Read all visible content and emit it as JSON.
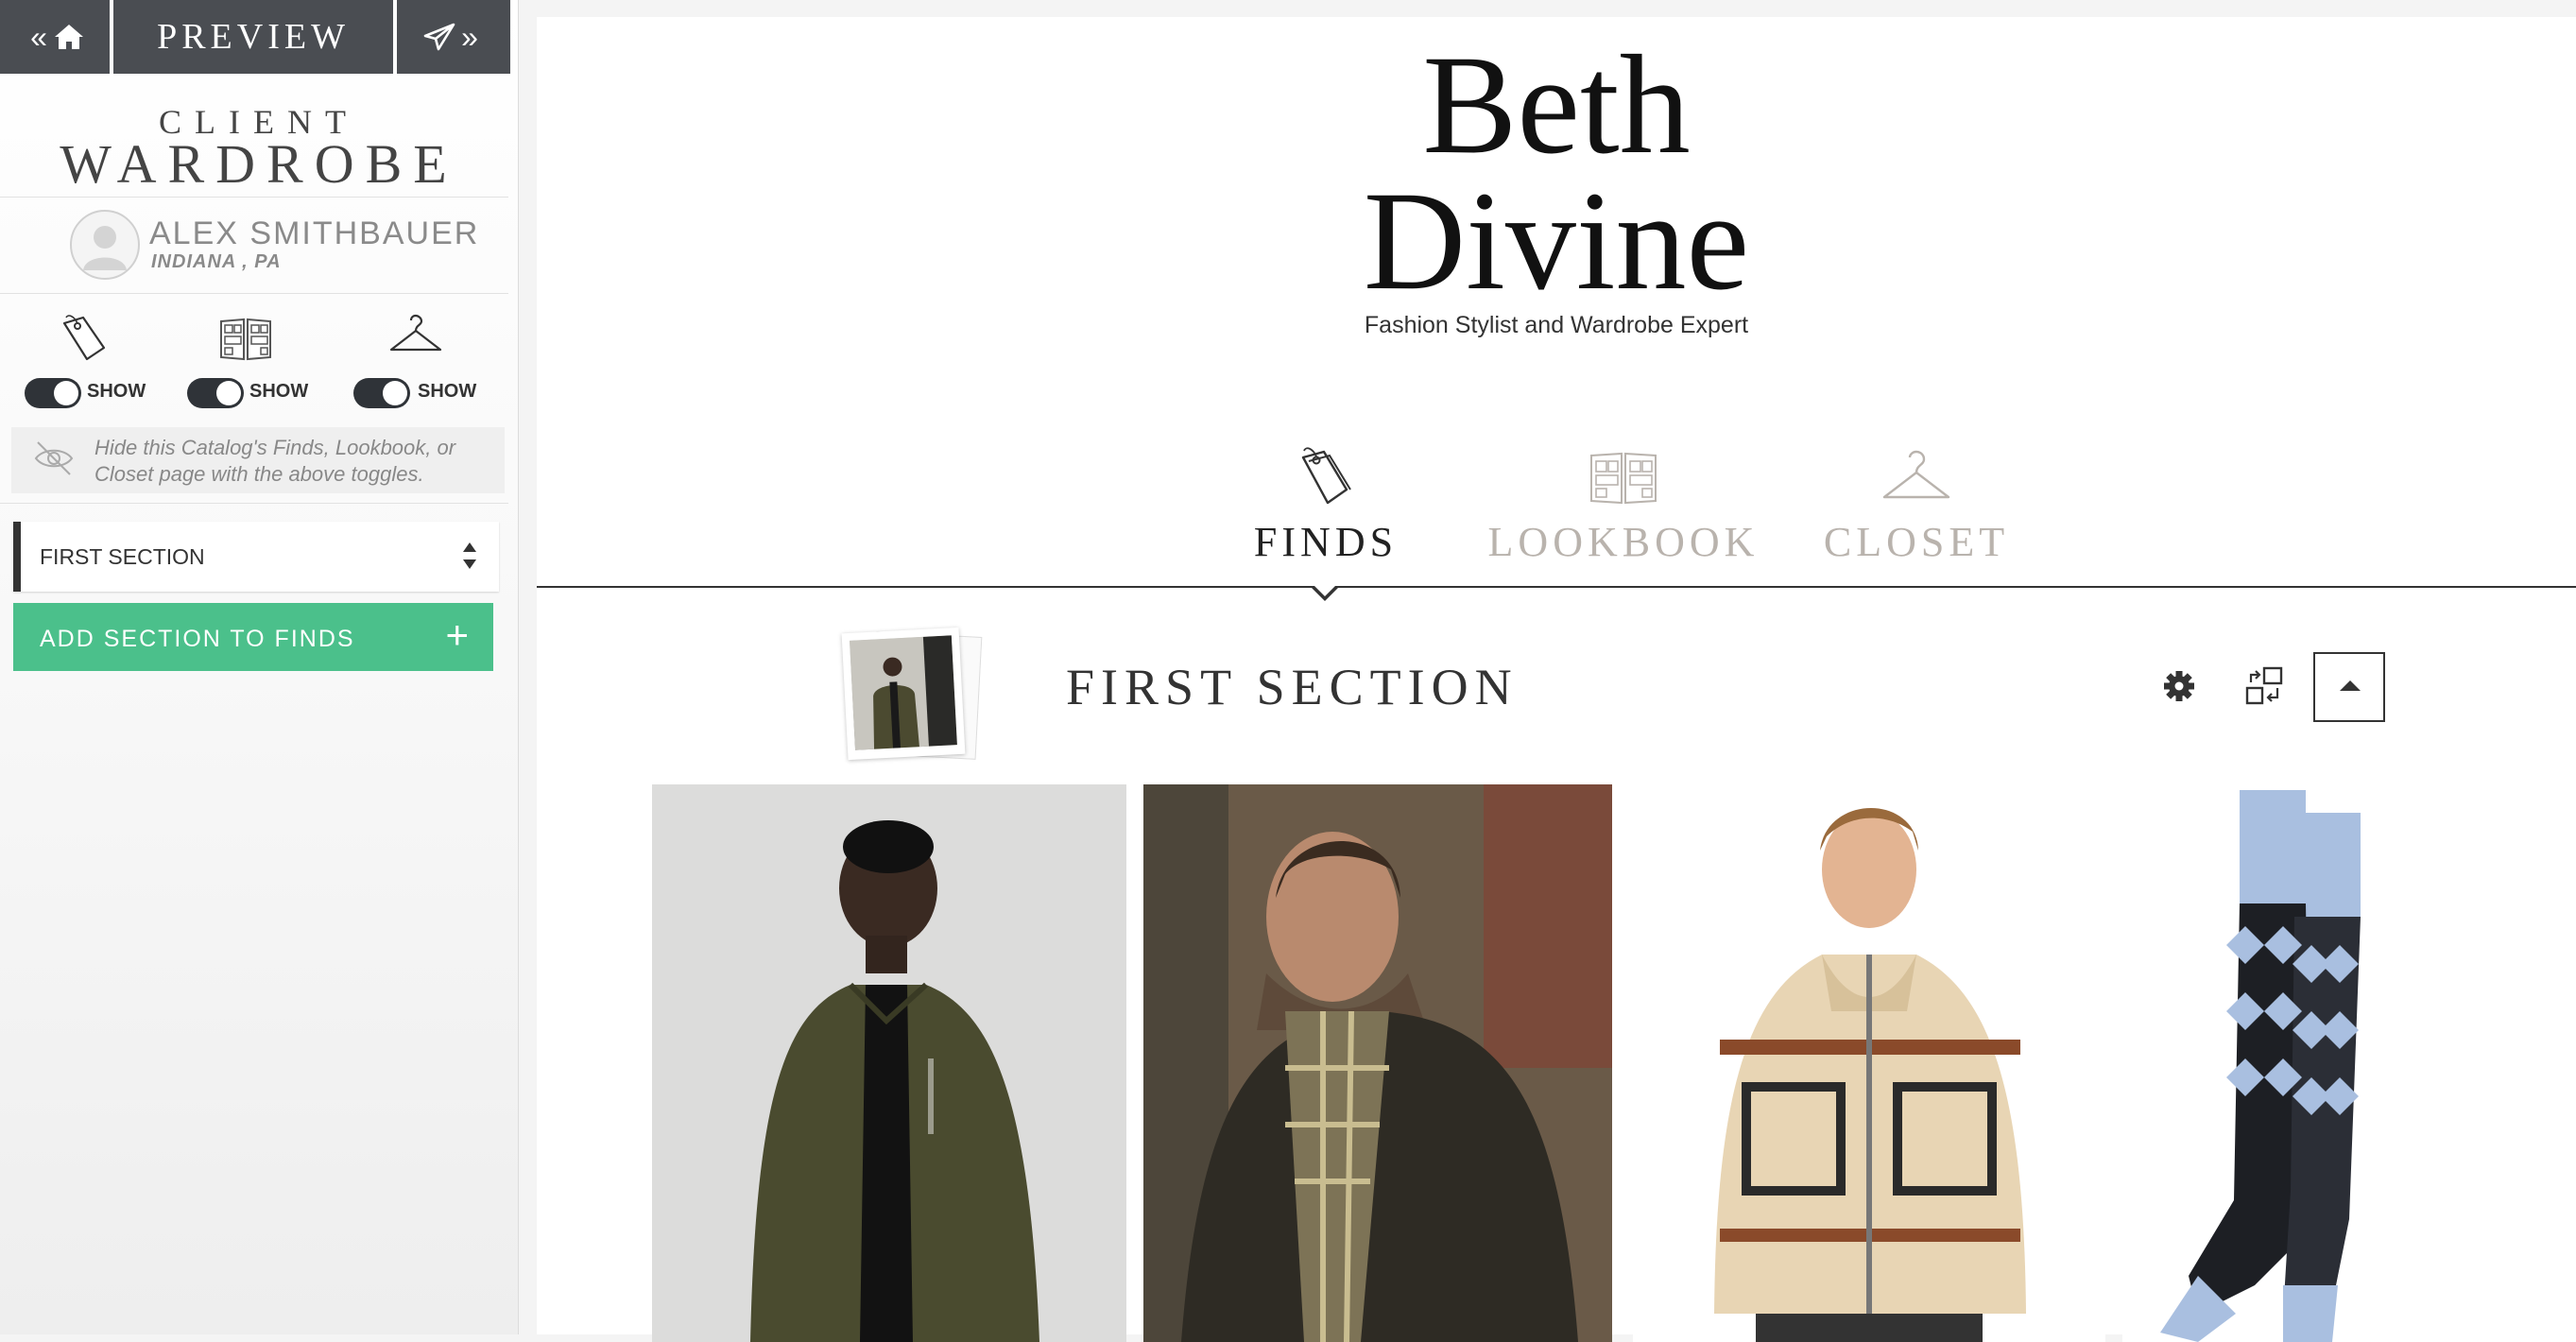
{
  "sidebar": {
    "preview_label": "PREVIEW",
    "title_line1": "CLIENT",
    "title_line2": "WARDROBE",
    "client": {
      "name": "ALEX SMITHBAUER",
      "location": "INDIANA , PA"
    },
    "toggles": [
      {
        "icon": "price-tag-icon",
        "label": "SHOW",
        "on": true
      },
      {
        "icon": "lookbook-icon",
        "label": "SHOW",
        "on": true
      },
      {
        "icon": "hanger-icon",
        "label": "SHOW",
        "on": true
      }
    ],
    "hint": "Hide this Catalog's Finds, Lookbook, or Closet page with the above toggles.",
    "section_select": "FIRST SECTION",
    "add_section_label": "ADD SECTION TO FINDS",
    "add_section_icon": "+"
  },
  "main": {
    "brand_line1": "Beth",
    "brand_line2": "Divine",
    "brand_subtitle": "Fashion Stylist and Wardrobe Expert",
    "tabs": [
      {
        "label": "FINDS",
        "icon": "price-tag-icon",
        "active": true
      },
      {
        "label": "LOOKBOOK",
        "icon": "lookbook-icon",
        "active": false
      },
      {
        "label": "CLOSET",
        "icon": "hanger-icon",
        "active": false
      }
    ],
    "section": {
      "title": "FIRST SECTION",
      "items": [
        {
          "image": "man-olive-bomber-jacket"
        },
        {
          "image": "man-plaid-scarf-sweater"
        },
        {
          "image": "man-patterned-cardigan"
        },
        {
          "image": "patterned-dress-socks"
        }
      ]
    }
  },
  "colors": {
    "topbar": "#4a4d52",
    "accent_green": "#4bc08b",
    "toggle_on": "#2f3338",
    "inactive_tab": "#b9b3ad"
  }
}
